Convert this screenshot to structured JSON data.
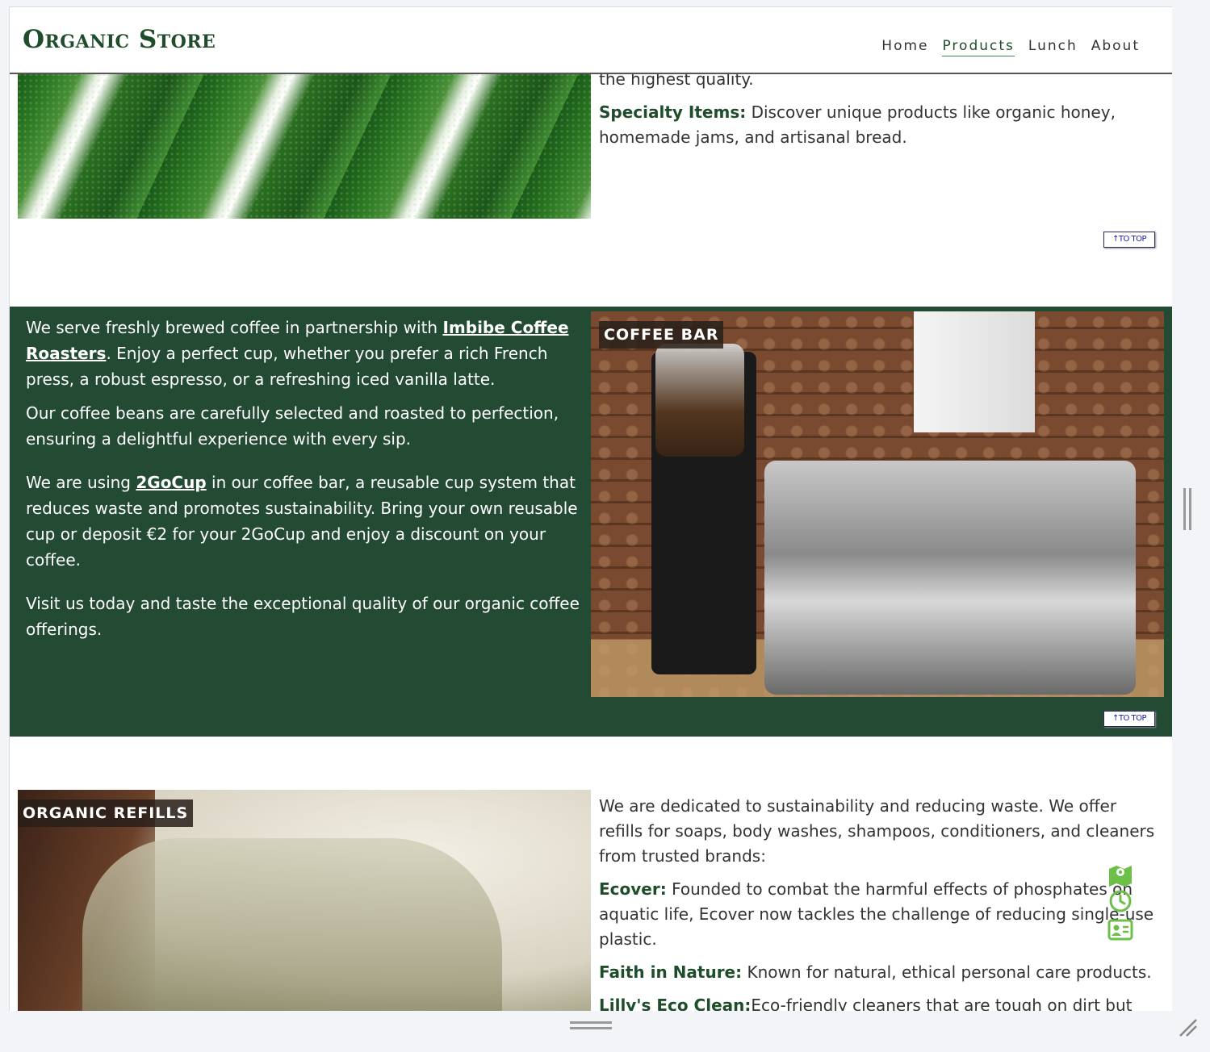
{
  "header": {
    "logo": "Organic Store",
    "nav": [
      {
        "label": "Home"
      },
      {
        "label": "Products",
        "active": true
      },
      {
        "label": "Lunch"
      },
      {
        "label": "About"
      }
    ]
  },
  "section_products": {
    "partial_line": "the highest quality.",
    "specialty_label": "Specialty Items:",
    "specialty_text": " Discover unique products like organic honey, homemade jams, and artisanal bread.",
    "to_top": "↑TO TOP"
  },
  "section_coffee": {
    "badge": "COFFEE BAR",
    "p1_a": "We serve freshly brewed coffee in partnership with ",
    "p1_link": "Imbibe Coffee Roasters",
    "p1_b": ". Enjoy a perfect cup, whether you prefer a rich French press, a robust espresso, or a refreshing iced vanilla latte.",
    "p2": "Our coffee beans are carefully selected and roasted to perfection, ensuring a delightful experience with every sip.",
    "p3_a": "We are using ",
    "p3_link": "2GoCup",
    "p3_b": " in our coffee bar, a reusable cup system that reduces waste and promotes sustainability. Bring your own reusable cup or deposit €2 for your 2GoCup and enjoy a discount on your coffee.",
    "p4": "Visit us today and taste the exceptional quality of our organic coffee offerings.",
    "to_top": "↑TO TOP"
  },
  "section_refills": {
    "badge": "ORGANIC REFILLS",
    "intro": "We are dedicated to sustainability and reducing waste. We offer refills for soaps, body washes, shampoos, conditioners, and cleaners from trusted brands:",
    "brands": [
      {
        "name": "Ecover:",
        "desc": " Founded to combat the harmful effects of phosphates on aquatic life, Ecover now tackles the challenge of reducing single-use plastic."
      },
      {
        "name": "Faith in Nature:",
        "desc": " Known for natural, ethical personal care products."
      },
      {
        "name": "Lilly's Eco Clean:",
        "desc": "Eco-friendly cleaners that are tough on dirt but"
      }
    ]
  },
  "floating_icons": [
    "map-icon",
    "clock-icon",
    "contact-card-icon"
  ],
  "colors": {
    "brand_green": "#234a32",
    "logo_green": "#1f4d2c",
    "icon_green": "#6cc04a"
  }
}
